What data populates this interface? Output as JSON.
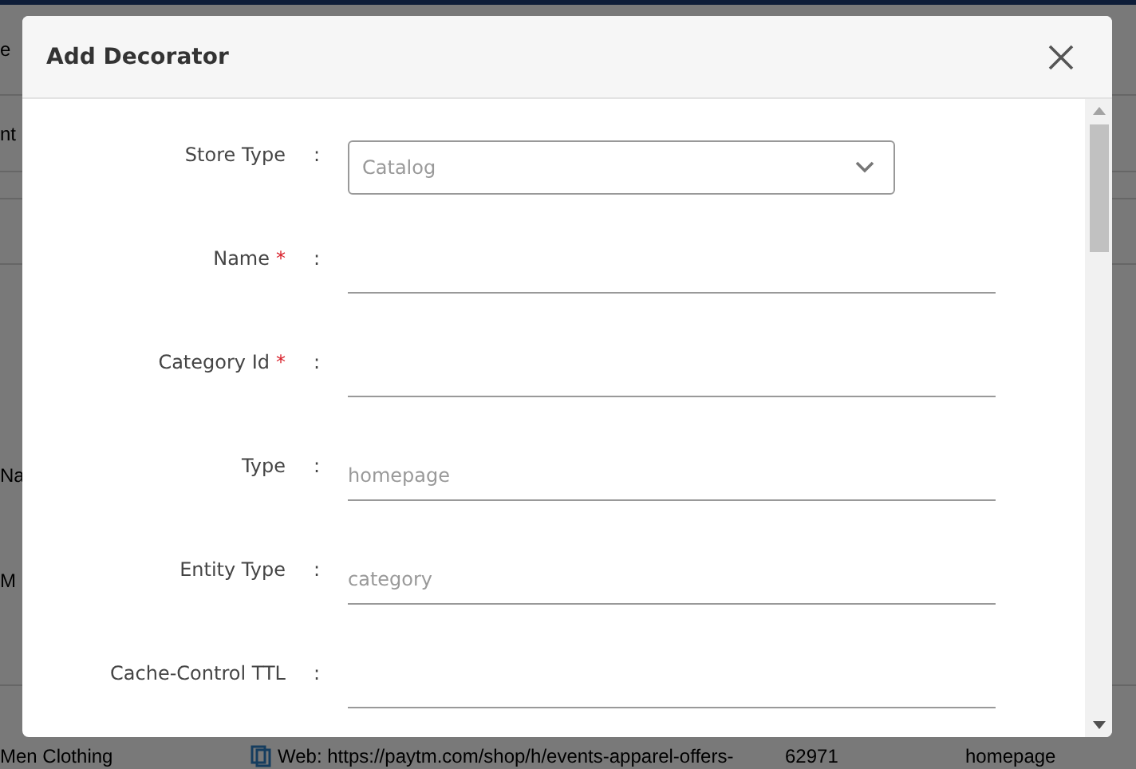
{
  "background": {
    "heading_fragment": "e",
    "subheading_fragment": "nt",
    "column_fragment": "Na",
    "row_fragment": "M",
    "row": {
      "name": "Men Clothing",
      "url": "Web: https://paytm.com/shop/h/events-apparel-offers-",
      "id": "62971",
      "type": "homepage"
    }
  },
  "dialog": {
    "title": "Add Decorator",
    "fields": [
      {
        "kind": "select",
        "label": "Store Type",
        "separator": ":",
        "value": "Catalog"
      },
      {
        "kind": "text",
        "label": "Name",
        "required_mark": "*",
        "separator": ":"
      },
      {
        "kind": "text",
        "label": "Category Id",
        "required_mark": "*",
        "separator": ":"
      },
      {
        "kind": "text",
        "label": "Type",
        "separator": ":",
        "placeholder": "homepage"
      },
      {
        "kind": "text",
        "label": "Entity Type",
        "separator": ":",
        "placeholder": "category"
      },
      {
        "kind": "text",
        "label": "Cache-Control TTL",
        "separator": ":"
      }
    ]
  }
}
